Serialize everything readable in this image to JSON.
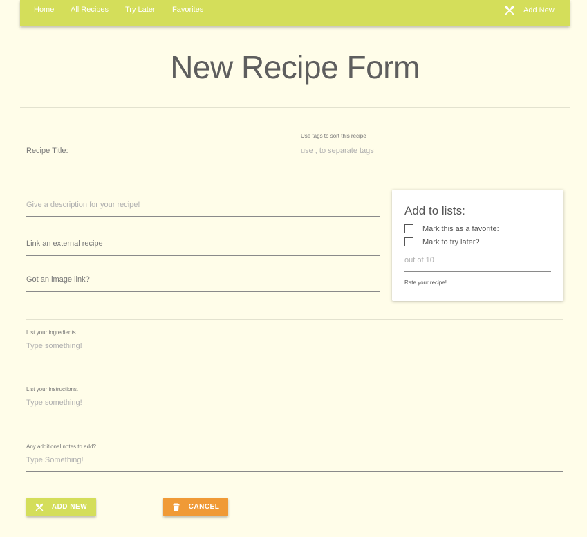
{
  "nav": {
    "links": [
      "Home",
      "All Recipes",
      "Try Later",
      "Favorites"
    ],
    "add_new": "Add New",
    "add_icon": "utensils-icon"
  },
  "page_title": "New Recipe Form",
  "form": {
    "recipe_title_label": "Recipe Title:",
    "tags_label": "Use tags to sort this recipe",
    "tags_placeholder": "use , to separate tags",
    "description_placeholder": "Give a description for your recipe!",
    "external_link_label": "Link an external recipe",
    "image_link_label": "Got an image link?",
    "ingredients_label": "List your ingredients",
    "ingredients_placeholder": "Type something!",
    "instructions_label": "List your instructions.",
    "instructions_placeholder": "Type something!",
    "notes_label": "Any additional notes to add?",
    "notes_placeholder": "Type Something!"
  },
  "lists_card": {
    "title": "Add to lists:",
    "favorite_label": "Mark this as a favorite:",
    "try_later_label": "Mark to try later?",
    "rating_placeholder": "out of 10",
    "rating_label": "Rate your recipe!"
  },
  "buttons": {
    "add_new": "ADD NEW",
    "cancel": "CANCEL",
    "add_color": "#d4de5a",
    "cancel_color": "#f09a36"
  },
  "colors": {
    "background": "#fffde9",
    "accent": "#d4de5a"
  }
}
